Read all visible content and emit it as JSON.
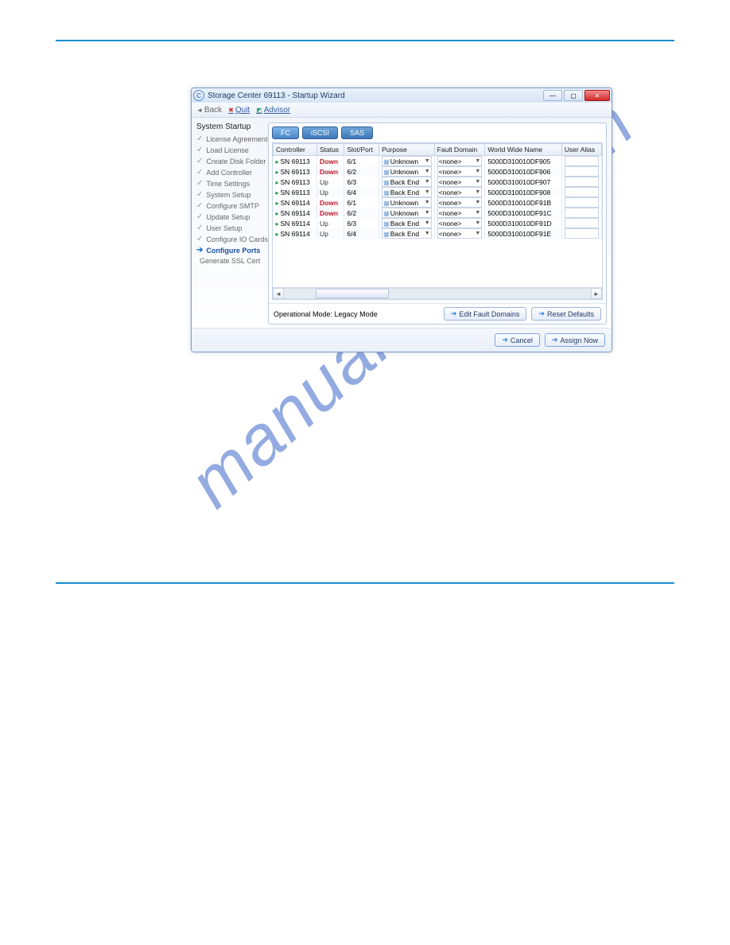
{
  "window": {
    "app_icon": "C",
    "title": "Storage Center 69113 - Startup Wizard"
  },
  "toolbar": {
    "back": "Back",
    "quit": "Quit",
    "advisor": "Advisor"
  },
  "sidebar": {
    "heading": "System Startup",
    "items": [
      {
        "label": "License Agreement",
        "state": "done"
      },
      {
        "label": "Load License",
        "state": "done"
      },
      {
        "label": "Create Disk Folder",
        "state": "done"
      },
      {
        "label": "Add Controller",
        "state": "done"
      },
      {
        "label": "Time Settings",
        "state": "done"
      },
      {
        "label": "System Setup",
        "state": "done"
      },
      {
        "label": "Configure SMTP",
        "state": "done"
      },
      {
        "label": "Update Setup",
        "state": "done"
      },
      {
        "label": "User Setup",
        "state": "done"
      },
      {
        "label": "Configure IO Cards",
        "state": "done"
      },
      {
        "label": "Configure Ports",
        "state": "active"
      },
      {
        "label": "Generate SSL Cert",
        "state": "todo"
      }
    ]
  },
  "tabs": [
    {
      "label": "FC",
      "active": true
    },
    {
      "label": "iSCSI",
      "active": false
    },
    {
      "label": "SAS",
      "active": false
    }
  ],
  "columns": [
    "Controller",
    "Status",
    "Slot/Port",
    "Purpose",
    "Fault Domain",
    "World Wide Name",
    "User Alias"
  ],
  "rows": [
    {
      "controller": "SN 69113",
      "status": "Down",
      "slot": "6/1",
      "purpose": "Unknown",
      "fault": "<none>",
      "wwn": "5000D310010DF905",
      "alias": ""
    },
    {
      "controller": "SN 69113",
      "status": "Down",
      "slot": "6/2",
      "purpose": "Unknown",
      "fault": "<none>",
      "wwn": "5000D310010DF906",
      "alias": ""
    },
    {
      "controller": "SN 69113",
      "status": "Up",
      "slot": "6/3",
      "purpose": "Back End",
      "fault": "<none>",
      "wwn": "5000D310010DF907",
      "alias": ""
    },
    {
      "controller": "SN 69113",
      "status": "Up",
      "slot": "6/4",
      "purpose": "Back End",
      "fault": "<none>",
      "wwn": "5000D310010DF908",
      "alias": ""
    },
    {
      "controller": "SN 69114",
      "status": "Down",
      "slot": "6/1",
      "purpose": "Unknown",
      "fault": "<none>",
      "wwn": "5000D310010DF91B",
      "alias": ""
    },
    {
      "controller": "SN 69114",
      "status": "Down",
      "slot": "6/2",
      "purpose": "Unknown",
      "fault": "<none>",
      "wwn": "5000D310010DF91C",
      "alias": ""
    },
    {
      "controller": "SN 69114",
      "status": "Up",
      "slot": "6/3",
      "purpose": "Back End",
      "fault": "<none>",
      "wwn": "5000D310010DF91D",
      "alias": ""
    },
    {
      "controller": "SN 69114",
      "status": "Up",
      "slot": "6/4",
      "purpose": "Back End",
      "fault": "<none>",
      "wwn": "5000D310010DF91E",
      "alias": ""
    }
  ],
  "footer": {
    "op_mode": "Operational Mode: Legacy Mode",
    "edit_fault": "Edit Fault Domains",
    "reset": "Reset Defaults"
  },
  "dialog_buttons": {
    "cancel": "Cancel",
    "assign": "Assign Now"
  },
  "watermark": "manualshive.com"
}
